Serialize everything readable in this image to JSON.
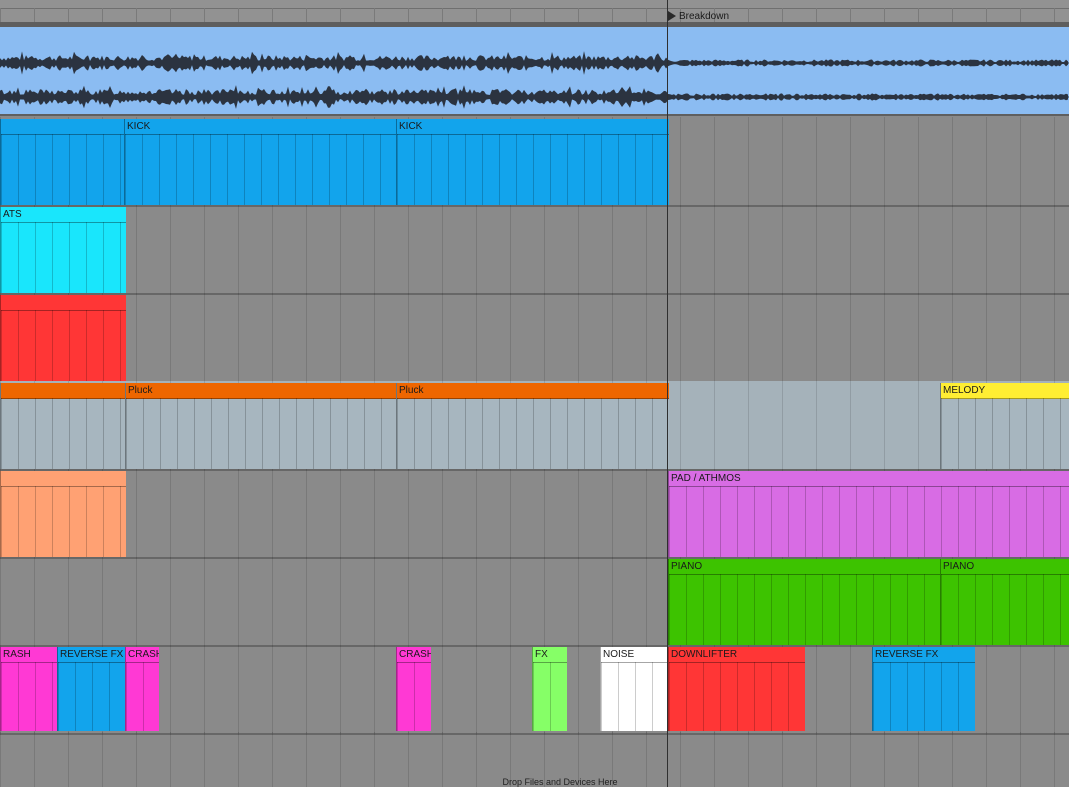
{
  "locator": {
    "label": "Breakdown"
  },
  "clips": {
    "kick_1": "KICK",
    "kick_2": "KICK",
    "hats": "ATS",
    "pluck_1": "Pluck",
    "pluck_2": "Pluck",
    "melody": "MELODY",
    "pad": "PAD / ATHMOS",
    "piano_1": "PIANO",
    "piano_2": "PIANO",
    "crash_1": "RASH",
    "reverse_fx_1": "REVERSE FX",
    "crash_2": "CRASH",
    "crash_3": "CRASH",
    "fx": "FX",
    "noise": "NOISE",
    "downlifter": "DOWNLIFTER",
    "reverse_fx_2": "REVERSE FX"
  },
  "colors": {
    "audio_clip": "#8bbcf2",
    "kick": "#12a4ec",
    "hats": "#19e6fc",
    "red": "#ff3636",
    "pluck_header": "#ee6600",
    "pluck_body": "#a7b6bf",
    "melody": "#ffee33",
    "peach": "#ffa173",
    "pad": "#d86ce4",
    "piano": "#3dc300",
    "crash": "#ff39d4",
    "reverse_fx": "#12a4ec",
    "fx": "#86ff67",
    "noise": "#ffffff",
    "downlifter": "#ff3636"
  },
  "dropzone": {
    "text": "Drop Files and Devices Here"
  }
}
